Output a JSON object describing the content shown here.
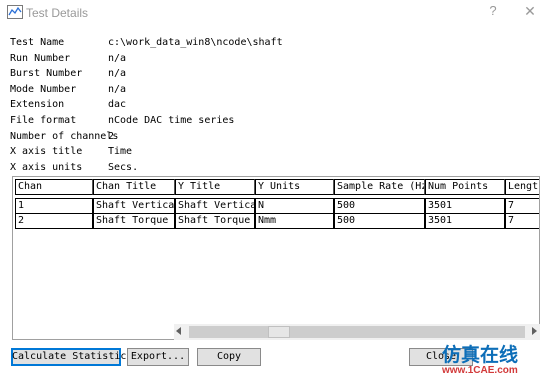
{
  "window": {
    "title": "Test Details",
    "help_glyph": "?",
    "close_glyph": "✕"
  },
  "info": [
    {
      "key": "Test Name",
      "value": "c:\\work_data_win8\\ncode\\shaft"
    },
    {
      "key": "Run Number",
      "value": "n/a"
    },
    {
      "key": "Burst Number",
      "value": "n/a"
    },
    {
      "key": "Mode Number",
      "value": "n/a"
    },
    {
      "key": "Extension",
      "value": "dac"
    },
    {
      "key": "File format",
      "value": "nCode DAC time series"
    },
    {
      "key": "Number of channels",
      "value": "2"
    },
    {
      "key": "X axis title",
      "value": "Time"
    },
    {
      "key": "X axis units",
      "value": "Secs."
    }
  ],
  "table": {
    "columns": [
      "Chan",
      "Chan Title",
      "Y Title",
      "Y Units",
      "Sample Rate (Hz)",
      "Num Points",
      "Length"
    ],
    "rows": [
      [
        "1",
        "Shaft Vertical",
        "Shaft Vertical",
        "N",
        "500",
        "3501",
        "7"
      ],
      [
        "2",
        "Shaft Torque",
        "Shaft Torque",
        "Nmm",
        "500",
        "3501",
        "7"
      ]
    ],
    "scroll_position": 0.25
  },
  "buttons": {
    "calculate": "Calculate Statistics",
    "export": "Export...",
    "copy": "Copy",
    "close": "Close"
  },
  "watermark": {
    "title": "仿真在线",
    "url": "www.1CAE.com"
  },
  "colors": {
    "focus_border": "#0078d7",
    "watermark_blue": "#0d6eb8",
    "watermark_red": "#d23a3a"
  }
}
